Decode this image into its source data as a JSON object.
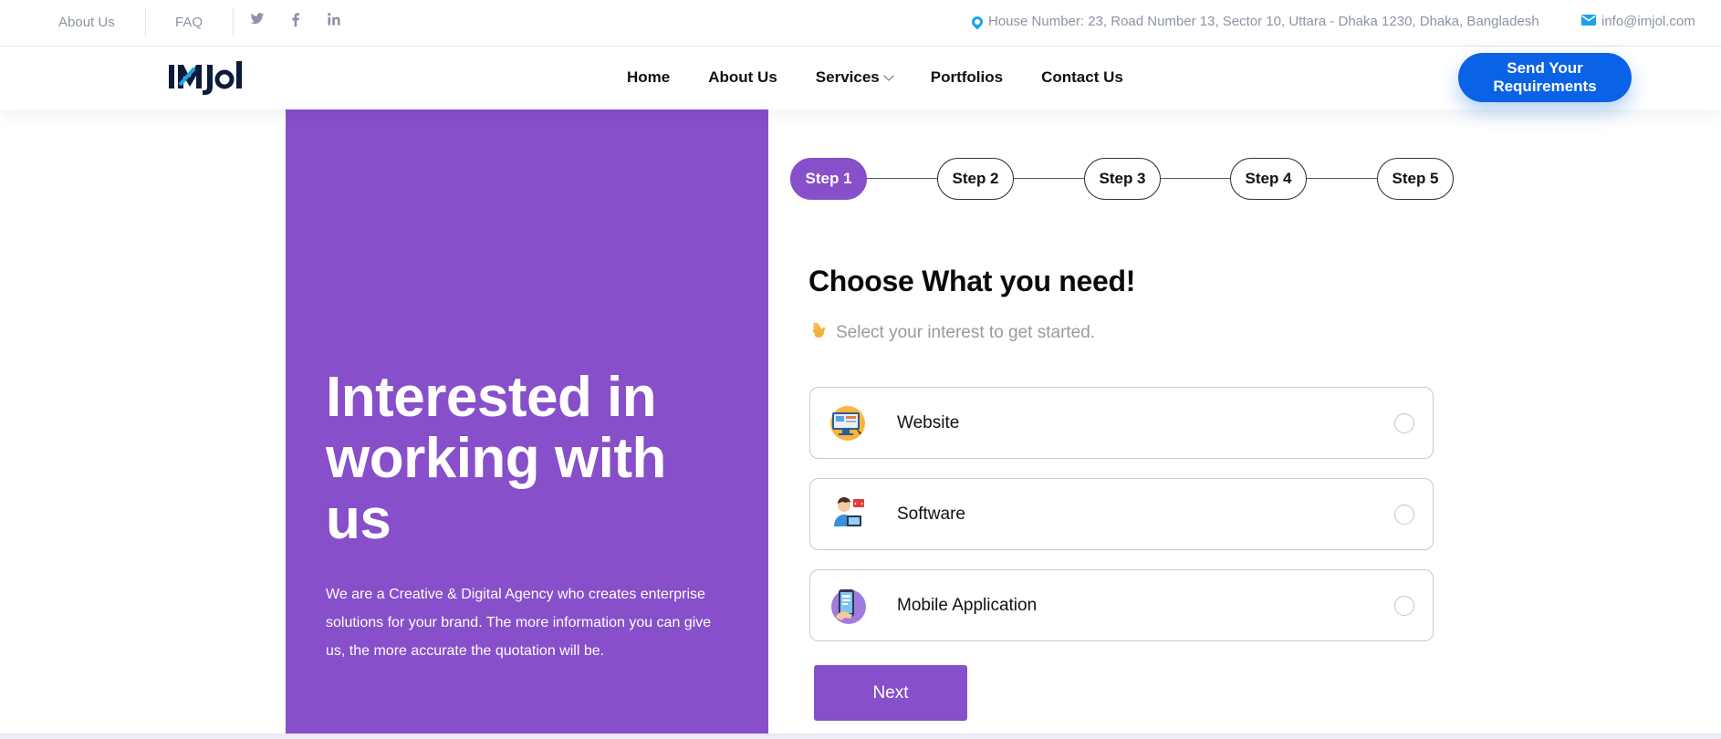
{
  "topbar": {
    "about_label": "About Us",
    "faq_label": "FAQ",
    "address": "House Number: 23, Road Number 13, Sector 10, Uttara - Dhaka 1230, Dhaka, Bangladesh",
    "email": "info@imjol.com",
    "social_icons": [
      "twitter-icon",
      "facebook-icon",
      "linkedin-icon"
    ]
  },
  "nav": {
    "logo_text": "Imjol",
    "links": [
      "Home",
      "About Us",
      "Services",
      "Portfolios",
      "Contact Us"
    ],
    "cta_label": "Send Your Requirements"
  },
  "hero": {
    "heading": "Interested in working with us",
    "description": "We are a Creative & Digital Agency who creates enterprise solutions for your brand. The more information you can give us, the more accurate the quotation will be."
  },
  "steps": [
    "Step 1",
    "Step 2",
    "Step 3",
    "Step 4",
    "Step 5"
  ],
  "active_step": 1,
  "form": {
    "title": "Choose What you need!",
    "subtitle": "Select your interest to get started.",
    "options": [
      "Website",
      "Software",
      "Mobile Application"
    ],
    "next_label": "Next"
  },
  "colors": {
    "accent_purple": "#874fca",
    "cta_blue": "#0a63e6",
    "icon_blue": "#1aa3e8"
  }
}
